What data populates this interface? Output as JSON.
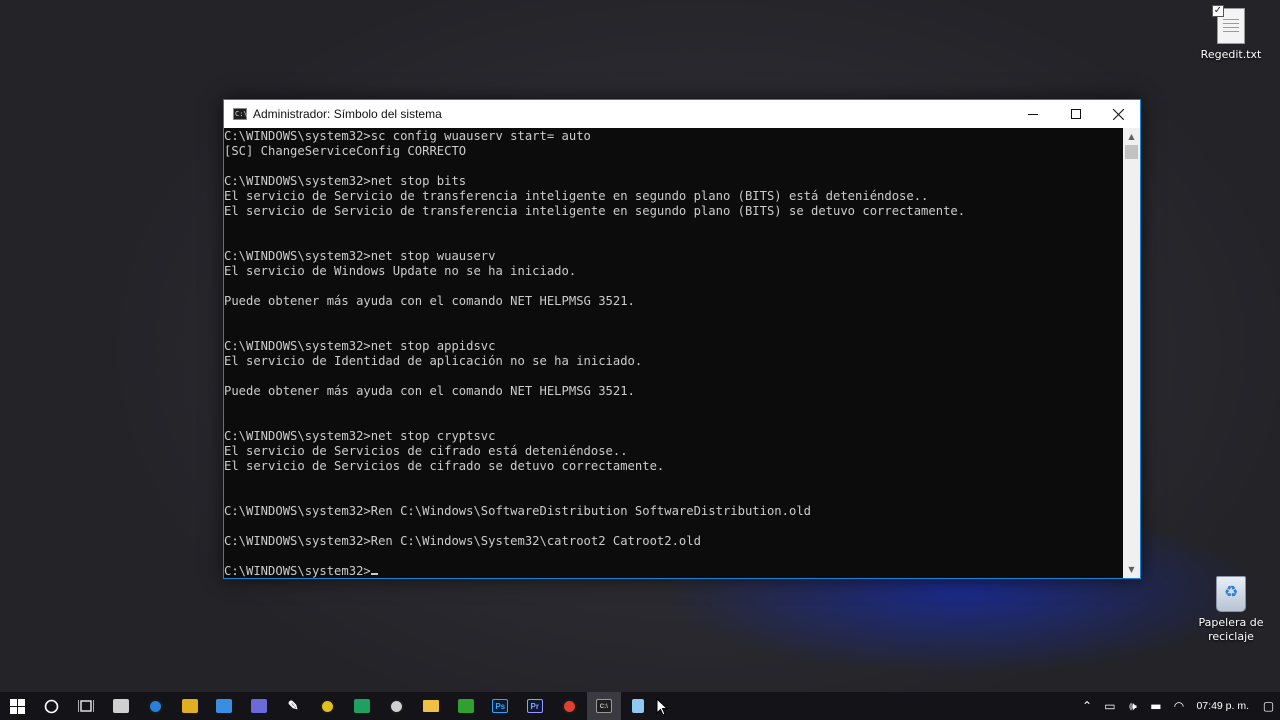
{
  "desktop": {
    "icons": [
      {
        "label": "Regedit.txt"
      },
      {
        "label": "Papelera de reciclaje"
      }
    ]
  },
  "window": {
    "title": "Administrador: Símbolo del sistema",
    "icon_text": "C:\\",
    "lines": [
      "C:\\WINDOWS\\system32>sc config wuauserv start= auto",
      "[SC] ChangeServiceConfig CORRECTO",
      "",
      "C:\\WINDOWS\\system32>net stop bits",
      "El servicio de Servicio de transferencia inteligente en segundo plano (BITS) está deteniéndose..",
      "El servicio de Servicio de transferencia inteligente en segundo plano (BITS) se detuvo correctamente.",
      "",
      "",
      "C:\\WINDOWS\\system32>net stop wuauserv",
      "El servicio de Windows Update no se ha iniciado.",
      "",
      "Puede obtener más ayuda con el comando NET HELPMSG 3521.",
      "",
      "",
      "C:\\WINDOWS\\system32>net stop appidsvc",
      "El servicio de Identidad de aplicación no se ha iniciado.",
      "",
      "Puede obtener más ayuda con el comando NET HELPMSG 3521.",
      "",
      "",
      "C:\\WINDOWS\\system32>net stop cryptsvc",
      "El servicio de Servicios de cifrado está deteniéndose..",
      "El servicio de Servicios de cifrado se detuvo correctamente.",
      "",
      "",
      "C:\\WINDOWS\\system32>Ren C:\\Windows\\SoftwareDistribution SoftwareDistribution.old",
      "",
      "C:\\WINDOWS\\system32>Ren C:\\Windows\\System32\\catroot2 Catroot2.old",
      "",
      "C:\\WINDOWS\\system32>"
    ],
    "buttons": {
      "minimize": "minimize",
      "maximize": "maximize",
      "close": "close"
    }
  },
  "taskbar": {
    "apps": [
      {
        "name": "start",
        "icon": "windows-logo"
      },
      {
        "name": "cortana",
        "icon": "circle"
      },
      {
        "name": "task-view",
        "icon": "task-view"
      },
      {
        "name": "app-1",
        "icon": "shield",
        "color": "#d0d0d0"
      },
      {
        "name": "firefox",
        "icon": "firefox",
        "color": "#2a7fd8"
      },
      {
        "name": "app-3",
        "icon": "file-yellow",
        "color": "#e0b020"
      },
      {
        "name": "app-4",
        "icon": "square-orange",
        "color": "#3a8ee0"
      },
      {
        "name": "app-5",
        "icon": "discord",
        "color": "#6a6ad8"
      },
      {
        "name": "app-6",
        "icon": "feather",
        "color": "#ffffff"
      },
      {
        "name": "app-7",
        "icon": "ring",
        "color": "#e0c020"
      },
      {
        "name": "app-8",
        "icon": "green-square",
        "color": "#20a060"
      },
      {
        "name": "app-9",
        "icon": "search-bubble",
        "color": "#d0d0d0"
      },
      {
        "name": "file-explorer",
        "icon": "folder",
        "color": "#f0c040"
      },
      {
        "name": "app-11",
        "icon": "green-x",
        "color": "#30a030"
      },
      {
        "name": "photoshop",
        "icon": "Ps",
        "color": "#31a8ff"
      },
      {
        "name": "premiere",
        "icon": "Pr",
        "color": "#9999ff"
      },
      {
        "name": "chrome",
        "icon": "chrome",
        "color": "#e04030"
      },
      {
        "name": "cmd",
        "icon": "C:\\",
        "color": "#cccccc",
        "active": true
      },
      {
        "name": "notepad",
        "icon": "notepad",
        "color": "#8fc8f0"
      }
    ],
    "tray": {
      "clock": "07:49 p. m."
    }
  }
}
